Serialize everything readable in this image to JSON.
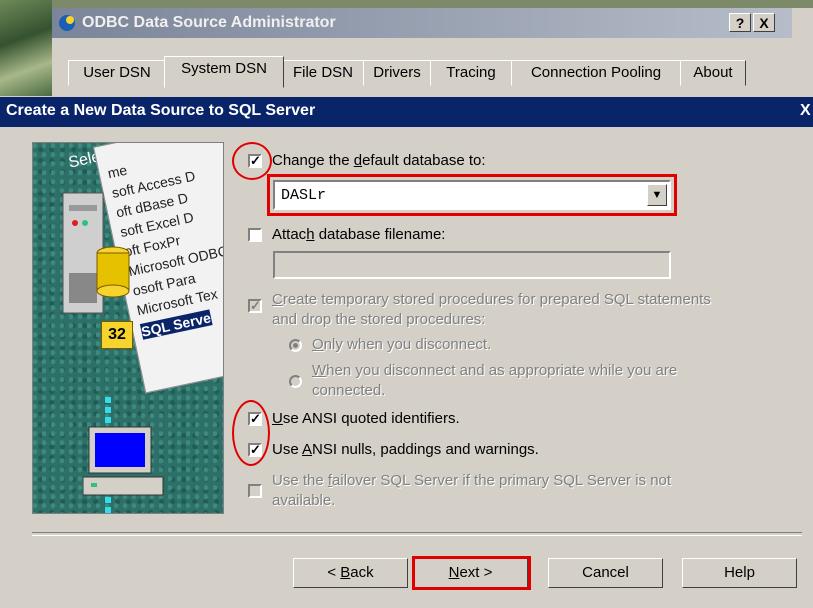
{
  "bg_window": {
    "title": "ODBC Data Source Administrator",
    "help_button": "?",
    "close_button": "X",
    "tabs": [
      "User DSN",
      "System DSN",
      "File DSN",
      "Drivers",
      "Tracing",
      "Connection Pooling",
      "About"
    ],
    "selected_tab": "System DSN"
  },
  "dialog": {
    "title": "Create a New Data Source to SQL Server",
    "close_glyph": "X"
  },
  "illustration": {
    "header": "Select a driver for",
    "drivers": [
      "me",
      "soft Access D",
      "oft dBase D",
      "soft Excel D",
      "oft FoxPr",
      "Microsoft ODBC",
      "osoft Para",
      "Microsoft Tex",
      "SQL Serve"
    ],
    "badge": "32"
  },
  "form": {
    "change_db": {
      "checked": true,
      "label_pre": "Change the ",
      "label_u": "d",
      "label_post": "efault database to:"
    },
    "db_value": "DASLr",
    "attach": {
      "checked": false,
      "label_pre": "Attac",
      "label_u": "h",
      "label_post": " database filename:",
      "value": ""
    },
    "temp_procs": {
      "checked": true,
      "enabled": false,
      "line1_u": "C",
      "line1": "reate temporary stored procedures for prepared SQL statements",
      "line2": "and drop the stored procedures:"
    },
    "radio_disconnect": {
      "selected": true,
      "label_u": "O",
      "label": "nly when you disconnect."
    },
    "radio_appropriate": {
      "selected": false,
      "label_u": "W",
      "label": "hen you disconnect and as appropriate while you are",
      "line2": "connected."
    },
    "ansi_quoted": {
      "checked": true,
      "label_u": "U",
      "label": "se ANSI quoted identifiers."
    },
    "ansi_nulls": {
      "checked": true,
      "label_pre": "Use ",
      "label_u": "A",
      "label": "NSI nulls, paddings and warnings."
    },
    "failover": {
      "checked": false,
      "enabled": false,
      "line1_pre": "Use the ",
      "line1_u": "f",
      "line1": "ailover SQL Server if the primary SQL Server is not",
      "line2": "available."
    }
  },
  "buttons": {
    "back_pre": "< ",
    "back_u": "B",
    "back": "ack",
    "next_u": "N",
    "next": "ext >",
    "cancel": "Cancel",
    "help": "Help"
  },
  "colors": {
    "annotation_red": "#e00000",
    "title_bar": "#0a246a",
    "dialog_face": "#d4d0c8"
  }
}
